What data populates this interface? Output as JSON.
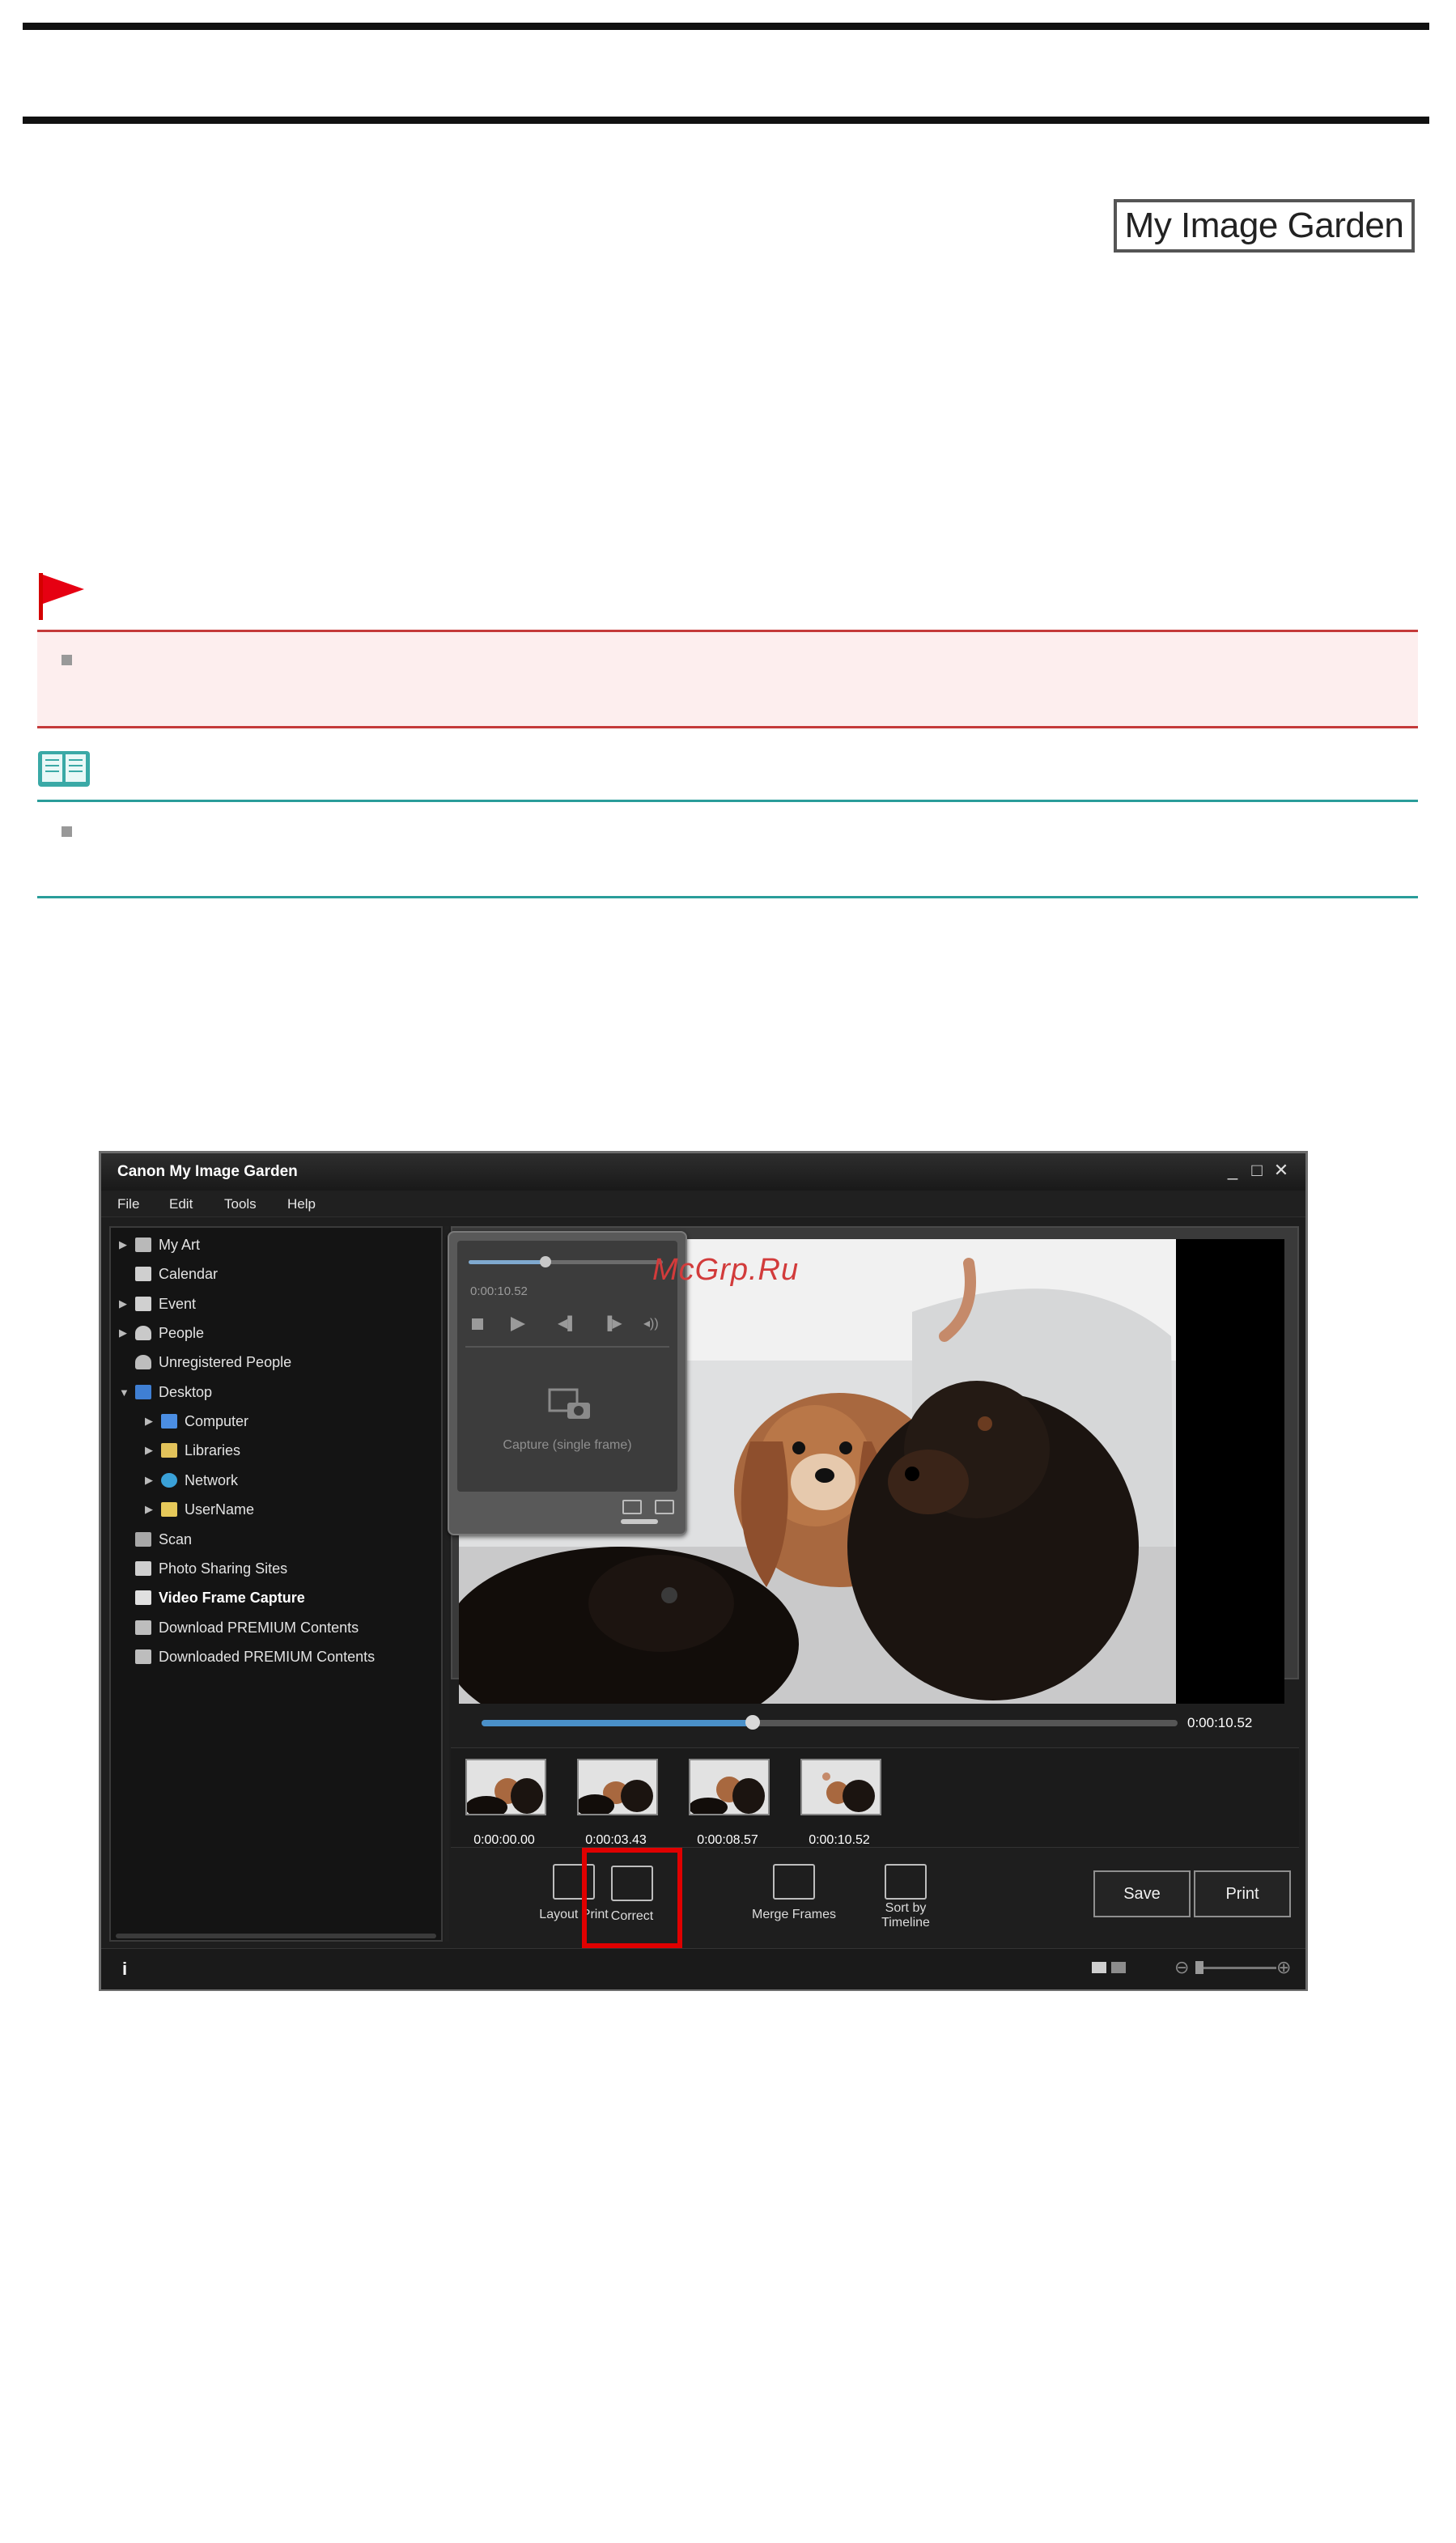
{
  "header": {
    "app_label": "My Image Garden"
  },
  "watermark": "McGrp.Ru",
  "window": {
    "title": "Canon My Image Garden",
    "controls": [
      "_",
      "□",
      "✕"
    ],
    "menu": [
      "File",
      "Edit",
      "Tools",
      "Help"
    ],
    "tree": [
      {
        "label": "My Art",
        "expandable": true
      },
      {
        "label": "Calendar",
        "expandable": false
      },
      {
        "label": "Event",
        "expandable": true
      },
      {
        "label": "People",
        "expandable": true
      },
      {
        "label": "Unregistered People",
        "expandable": false
      },
      {
        "label": "Desktop",
        "expandable": true,
        "expanded": true
      },
      {
        "label": "Computer",
        "expandable": true,
        "child": true
      },
      {
        "label": "Libraries",
        "expandable": true,
        "child": true
      },
      {
        "label": "Network",
        "expandable": true,
        "child": true
      },
      {
        "label": "UserName",
        "expandable": true,
        "child": true
      },
      {
        "label": "Scan",
        "expandable": false
      },
      {
        "label": "Photo Sharing Sites",
        "expandable": false
      },
      {
        "label": "Video Frame Capture",
        "expandable": false,
        "selected": true
      },
      {
        "label": "Download PREMIUM Contents",
        "expandable": false
      },
      {
        "label": "Downloaded PREMIUM Contents",
        "expandable": false
      }
    ],
    "capture_panel": {
      "time": "0:00:10.52",
      "caption": "Capture (single frame)"
    },
    "seek": {
      "time": "0:00:10.52",
      "progress": 0.39
    },
    "thumbnails": [
      "0:00:00.00",
      "0:00:03.43",
      "0:00:08.57",
      "0:00:10.52"
    ],
    "toolbar": {
      "layout_print": "Layout Print",
      "correct": "Correct",
      "merge_frames": "Merge Frames",
      "sort_by_timeline_1": "Sort by",
      "sort_by_timeline_2": "Timeline",
      "save": "Save",
      "print": "Print"
    },
    "status": {
      "info": "i"
    }
  }
}
